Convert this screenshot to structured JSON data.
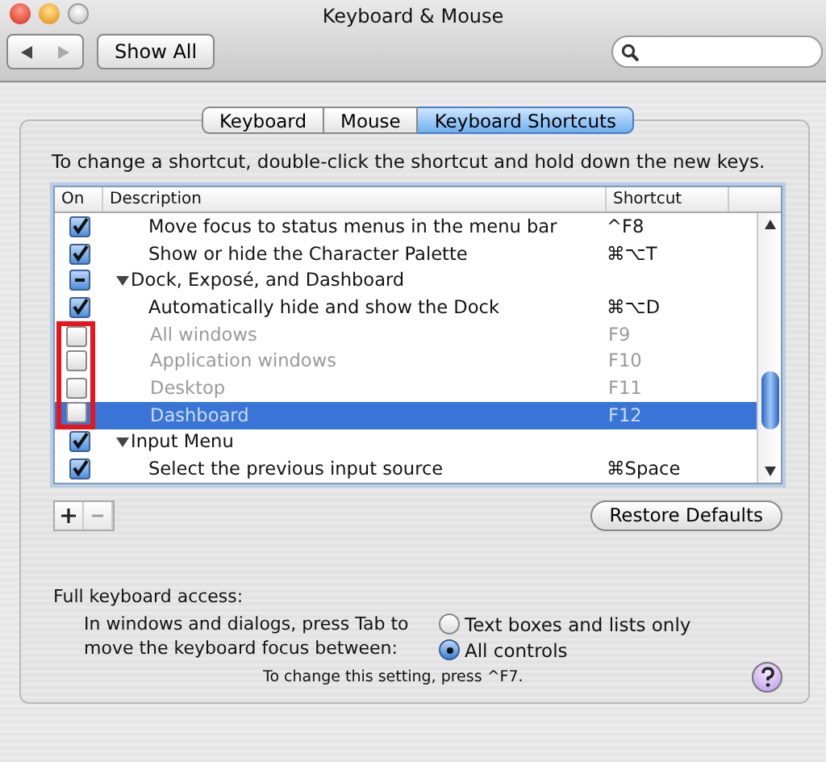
{
  "window": {
    "title": "Keyboard & Mouse"
  },
  "toolbar": {
    "show_all": "Show All"
  },
  "tabs": [
    {
      "label": "Keyboard",
      "selected": false
    },
    {
      "label": "Mouse",
      "selected": false
    },
    {
      "label": "Keyboard Shortcuts",
      "selected": true
    }
  ],
  "instruction": "To change a shortcut, double-click the shortcut and hold down the new keys.",
  "table": {
    "columns": [
      "On",
      "Description",
      "Shortcut"
    ],
    "rows": [
      {
        "kind": "item",
        "checked": true,
        "mixed": false,
        "disabled": false,
        "selected": false,
        "highlighted": false,
        "description": "Move focus to status menus in the menu bar",
        "shortcut": "^F8"
      },
      {
        "kind": "item",
        "checked": true,
        "mixed": false,
        "disabled": false,
        "selected": false,
        "highlighted": false,
        "description": "Show or hide the Character Palette",
        "shortcut": "⌘⌥T"
      },
      {
        "kind": "group",
        "checked": true,
        "mixed": true,
        "disabled": false,
        "selected": false,
        "highlighted": false,
        "description": "Dock, Exposé, and Dashboard",
        "expanded": true
      },
      {
        "kind": "item",
        "checked": true,
        "mixed": false,
        "disabled": false,
        "selected": false,
        "highlighted": false,
        "description": "Automatically hide and show the Dock",
        "shortcut": "⌘⌥D"
      },
      {
        "kind": "item",
        "checked": false,
        "mixed": false,
        "disabled": true,
        "selected": false,
        "highlighted": true,
        "description": "All windows",
        "shortcut": "F9"
      },
      {
        "kind": "item",
        "checked": false,
        "mixed": false,
        "disabled": true,
        "selected": false,
        "highlighted": true,
        "description": "Application windows",
        "shortcut": "F10"
      },
      {
        "kind": "item",
        "checked": false,
        "mixed": false,
        "disabled": true,
        "selected": false,
        "highlighted": true,
        "description": "Desktop",
        "shortcut": "F11"
      },
      {
        "kind": "item",
        "checked": false,
        "mixed": false,
        "disabled": true,
        "selected": true,
        "highlighted": true,
        "description": "Dashboard",
        "shortcut": "F12"
      },
      {
        "kind": "group",
        "checked": true,
        "mixed": false,
        "disabled": false,
        "selected": false,
        "highlighted": false,
        "description": "Input Menu",
        "expanded": true
      },
      {
        "kind": "item",
        "checked": true,
        "mixed": false,
        "disabled": false,
        "selected": false,
        "highlighted": false,
        "description": "Select the previous input source",
        "shortcut": "⌘Space"
      }
    ]
  },
  "restore_button": "Restore Defaults",
  "keyboard_access": {
    "heading": "Full keyboard access:",
    "prompt_lines": [
      "In windows and dialogs, press Tab to",
      "move the keyboard focus between:"
    ],
    "options": [
      {
        "label": "Text boxes and lists only",
        "selected": false
      },
      {
        "label": "All controls",
        "selected": true
      }
    ],
    "note": "To change this setting, press ^F7."
  }
}
